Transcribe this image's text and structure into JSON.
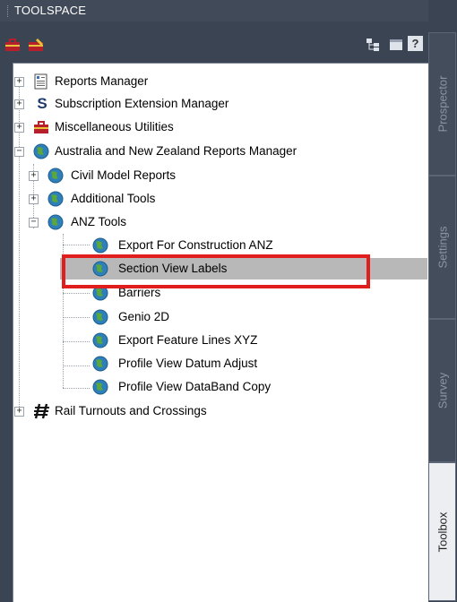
{
  "title": "TOOLSPACE",
  "toolbar": {
    "left_icons": [
      "toolbox-icon",
      "edit-toolbox-icon"
    ],
    "right_icons": [
      "tree-view-icon",
      "panel-view-icon",
      "help-icon"
    ],
    "help_label": "?"
  },
  "tree": [
    {
      "label": "Reports Manager",
      "icon": "reports-icon",
      "expander": "+"
    },
    {
      "label": "Subscription Extension Manager",
      "icon": "subscription-s-icon",
      "icon_text": "S",
      "expander": "+"
    },
    {
      "label": "Miscellaneous Utilities",
      "icon": "toolbox-icon",
      "expander": "+"
    },
    {
      "label": "Australia and New Zealand Reports Manager",
      "icon": "globe-icon",
      "expander": "−"
    },
    {
      "label": "Civil Model Reports",
      "icon": "globe-icon",
      "expander": "+"
    },
    {
      "label": "Additional Tools",
      "icon": "globe-icon",
      "expander": "+"
    },
    {
      "label": "ANZ Tools",
      "icon": "globe-icon",
      "expander": "−"
    },
    {
      "label": "Export For Construction ANZ",
      "icon": "globe-icon"
    },
    {
      "label": "Section View Labels",
      "icon": "globe-icon",
      "selected": true
    },
    {
      "label": "Barriers",
      "icon": "globe-icon"
    },
    {
      "label": "Genio 2D",
      "icon": "globe-icon"
    },
    {
      "label": "Export Feature Lines XYZ",
      "icon": "globe-icon"
    },
    {
      "label": "Profile View Datum Adjust",
      "icon": "globe-icon"
    },
    {
      "label": "Profile View DataBand Copy",
      "icon": "globe-icon"
    },
    {
      "label": "Rail Turnouts and Crossings",
      "icon": "rail-icon",
      "expander": "+"
    }
  ],
  "tabs": [
    {
      "label": "Prospector",
      "active": false
    },
    {
      "label": "Settings",
      "active": false
    },
    {
      "label": "Survey",
      "active": false
    },
    {
      "label": "Toolbox",
      "active": true
    }
  ],
  "colors": {
    "highlight_border": "#e01e1e",
    "selection": "#b8b8b8",
    "chrome": "#3b4453",
    "globe_blue": "#2f7fb8",
    "globe_green": "#5aa83c",
    "toolbox_red": "#b5202a"
  }
}
